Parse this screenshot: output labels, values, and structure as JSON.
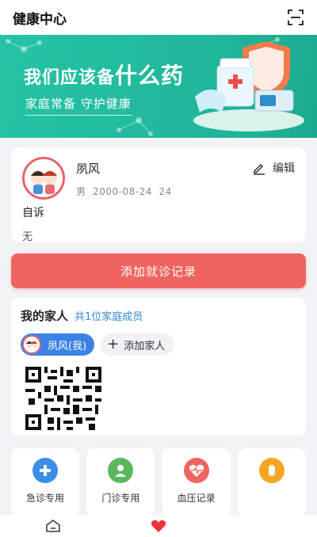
{
  "header": {
    "title": "健康中心",
    "scan_icon": "scan-icon"
  },
  "banner": {
    "title_part1": "我们应该备",
    "title_part2": "什么药",
    "subtitle": "家庭常备 守护健康"
  },
  "profile": {
    "name": "夙风",
    "gender": "男",
    "birthday": "2000-08-24",
    "age": "24",
    "edit_label": "编辑",
    "complaint_label": "自诉",
    "complaint_value": "无"
  },
  "actions": {
    "add_record_label": "添加就诊记录"
  },
  "family": {
    "title": "我的家人",
    "count_text": "共1位家庭成员",
    "member_me_label": "夙风(我)",
    "add_member_label": "添加家人"
  },
  "quick": [
    {
      "label": "急诊专用",
      "color": "#3a8ee6"
    },
    {
      "label": "门诊专用",
      "color": "#5cb85c"
    },
    {
      "label": "血压记录",
      "color": "#ef6460"
    },
    {
      "label": "",
      "color": "#f5a623"
    }
  ],
  "colors": {
    "accent_green": "#20b89c",
    "primary_red": "#ef6460",
    "link_blue": "#2e8ad8",
    "chip_blue": "#3b82e6"
  },
  "tabs": [
    {
      "icon": "home-icon"
    },
    {
      "icon": "heart-icon"
    }
  ]
}
